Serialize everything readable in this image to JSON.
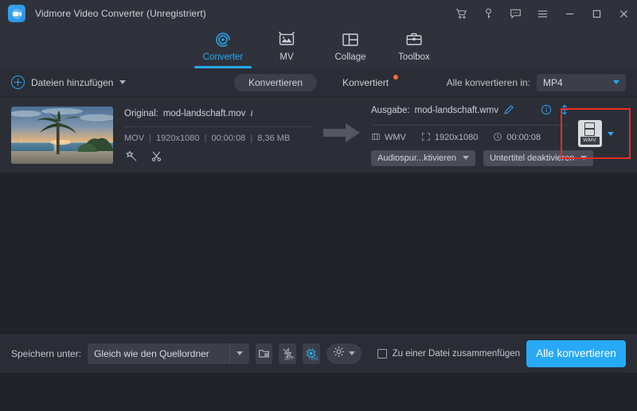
{
  "window": {
    "title": "Vidmore Video Converter (Unregistriert)",
    "logo_icon": "video-camera-logo-icon",
    "controls": [
      {
        "name": "cart-icon",
        "label": "Shop"
      },
      {
        "name": "key-icon",
        "label": "Registrieren"
      },
      {
        "name": "feedback-icon",
        "label": "Feedback"
      },
      {
        "name": "menu-icon",
        "label": "Menü"
      },
      {
        "name": "minimize-icon",
        "label": "Minimieren"
      },
      {
        "name": "maximize-icon",
        "label": "Maximieren"
      },
      {
        "name": "close-icon",
        "label": "Schließen"
      }
    ]
  },
  "tabs": [
    {
      "label": "Converter",
      "icon": "converter-icon",
      "active": true
    },
    {
      "label": "MV",
      "icon": "mv-icon",
      "active": false
    },
    {
      "label": "Collage",
      "icon": "collage-icon",
      "active": false
    },
    {
      "label": "Toolbox",
      "icon": "toolbox-icon",
      "active": false
    }
  ],
  "toolbar": {
    "add_files_label": "Dateien hinzufügen",
    "add_files_icon": "plus-circle-icon",
    "segments": [
      {
        "label": "Konvertieren",
        "active": true,
        "badge": false
      },
      {
        "label": "Konvertiert",
        "active": false,
        "badge": true
      }
    ],
    "convert_all_to_label": "Alle konvertieren in:",
    "convert_all_to_value": "MP4"
  },
  "file": {
    "thumbnail_alt": "palm-tree-beach-sunset-thumbnail",
    "source": {
      "title_prefix": "Original:",
      "filename": "mod-landschaft.mov",
      "info_icon": "info-italic-icon",
      "format": "MOV",
      "resolution": "1920x1080",
      "duration": "00:00:08",
      "size": "8,36 MB",
      "separator": "|",
      "actions": [
        {
          "name": "edit-magic-wand-icon",
          "label": "Bearbeiten"
        },
        {
          "name": "cut-scissors-icon",
          "label": "Schneiden"
        }
      ]
    },
    "output": {
      "title_prefix": "Ausgabe:",
      "filename": "mod-landschaft.wmv",
      "rename_icon": "pencil-edit-icon",
      "info_icon": "info-circle-icon",
      "resize_icon": "vertical-arrows-icon",
      "format": "WMV",
      "format_icon": "film-strip-icon",
      "resolution": "1920x1080",
      "resolution_icon": "resize-frame-icon",
      "duration": "00:00:08",
      "duration_icon": "clock-icon",
      "audio_track_label": "Audiospur...ktivieren",
      "subtitle_label": "Untertitel deaktivieren"
    },
    "format_button": {
      "badge_text": "WMV",
      "icon": "format-film-icon",
      "dropdown_icon": "caret-down-icon",
      "highlighted": true,
      "highlight_color": "#ee2a24"
    }
  },
  "bottom": {
    "save_to_label": "Speichern unter:",
    "save_to_value": "Gleich wie den Quellordner",
    "buttons": [
      {
        "name": "open-folder-icon",
        "label": "Ordner öffnen"
      },
      {
        "name": "fast-conversion-off-icon",
        "label": "OFF"
      },
      {
        "name": "gpu-acceleration-on-icon",
        "label": "ON"
      },
      {
        "name": "settings-gear-icon",
        "label": "Einstellungen"
      }
    ],
    "merge_checkbox_label": "Zu einer Datei zusammenfügen",
    "merge_checked": false,
    "convert_all_button": "Alle konvertieren"
  },
  "colors": {
    "accent": "#28a9f5",
    "titlebar_bg": "#2f323b",
    "panel_bg": "#2b2e37",
    "app_bg": "#212329",
    "badge_orange": "#f2713a",
    "highlight_red": "#ee2a24"
  }
}
